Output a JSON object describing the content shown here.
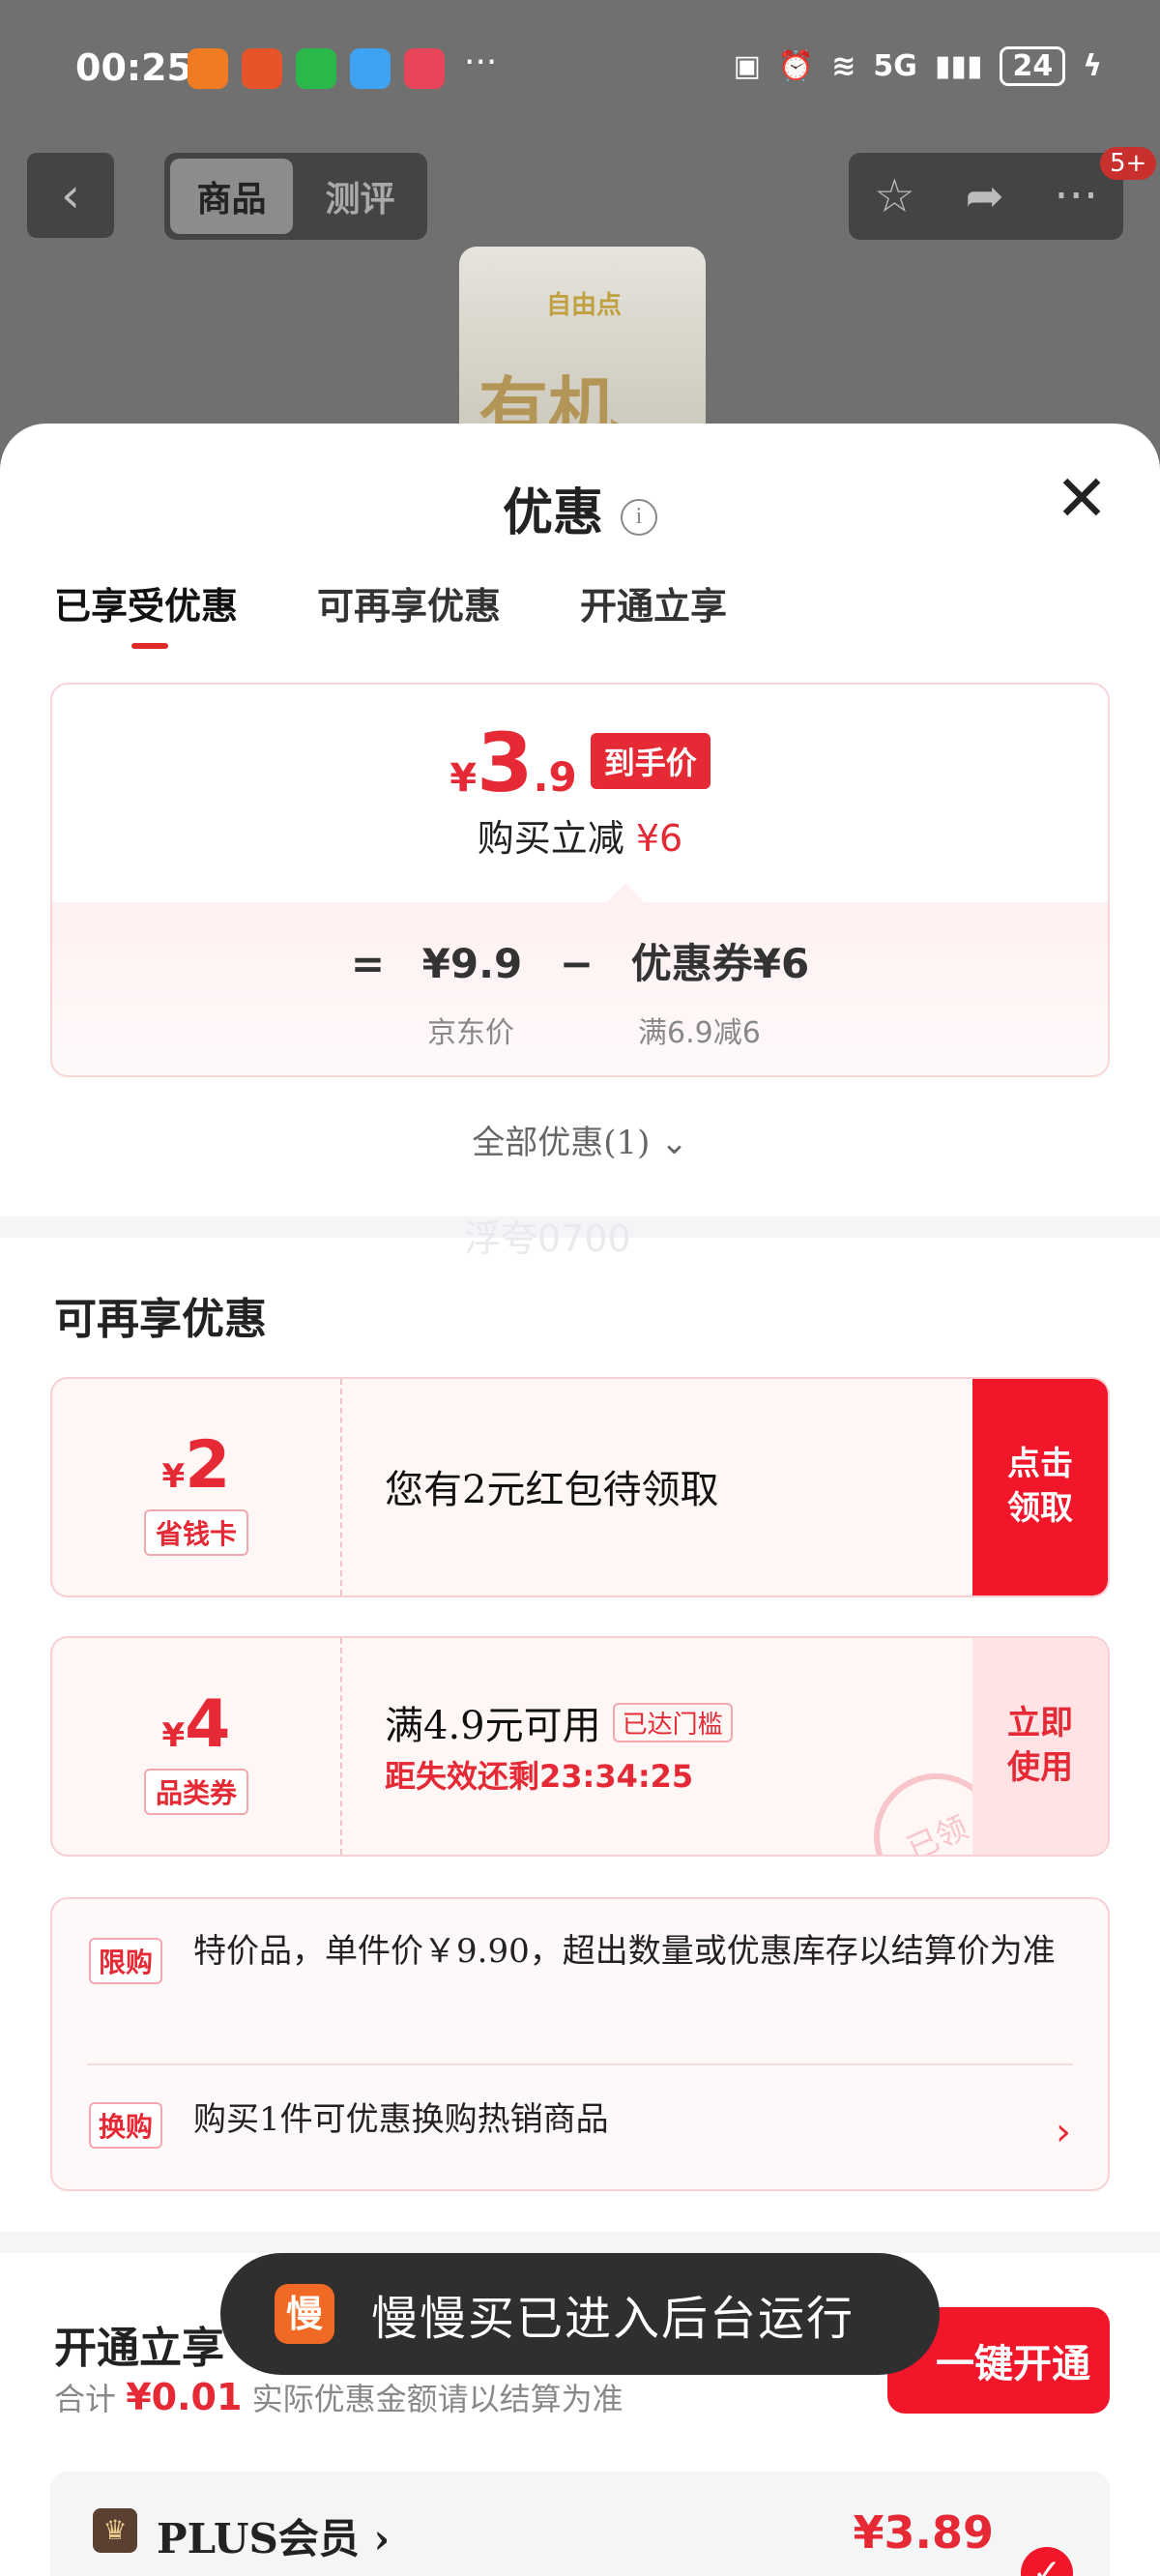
{
  "status_bar": {
    "time": "00:25",
    "more": "···",
    "network": "5G",
    "battery": "24"
  },
  "top_nav": {
    "back_icon": "chevron-left-icon",
    "tab_product": "商品",
    "tab_review": "测评",
    "badge": "5+"
  },
  "product": {
    "brand": "自由点",
    "big_text": "有机"
  },
  "sheet": {
    "title": "优惠",
    "info_icon": "i",
    "close": "✕",
    "tabs": [
      "已享受优惠",
      "可再享优惠",
      "开通立享"
    ]
  },
  "price_card": {
    "currency": "¥",
    "price_int": "3",
    "price_dec": ".9",
    "tag": "到手价",
    "reduce_label": "购买立减",
    "reduce_value": "¥6",
    "eq": "=",
    "base_price": "¥9.9",
    "minus": "−",
    "coupon_label": "优惠券¥6",
    "base_price_label": "京东价",
    "coupon_rule": "满6.9减6"
  },
  "all_discounts": "全部优惠(1)",
  "watermark": "浮夸0700",
  "more_section": {
    "title": "可再享优惠",
    "coupon1": {
      "currency": "¥",
      "amount": "2",
      "tag": "省钱卡",
      "text": "您有2元红包待领取",
      "button": "点击\n领取"
    },
    "coupon2": {
      "currency": "¥",
      "amount": "4",
      "tag": "品类券",
      "text": "满4.9元可用",
      "threshold": "已达门槛",
      "expire": "距失效还剩23:34:25",
      "button": "立即\n使用",
      "stamp": "已领"
    }
  },
  "rules": {
    "tag1": "限购",
    "text1": "特价品，单件价￥9.90，超出数量或优惠库存以结算价为准",
    "tag2": "换购",
    "text2": "购买1件可优惠换购热销商品"
  },
  "open_section": {
    "title": "开通立享",
    "sub_prefix": "合计",
    "sub_amount": "¥0.01",
    "sub_suffix": "实际优惠金额请以结算为准",
    "button": "一键开通",
    "plus_label": "PLUS会员",
    "plus_price": "¥3.89"
  },
  "toast": {
    "icon": "慢",
    "text": "慢慢买已进入后台运行"
  },
  "colors": {
    "accent": "#e52a36",
    "accent_solid": "#f2162a"
  }
}
